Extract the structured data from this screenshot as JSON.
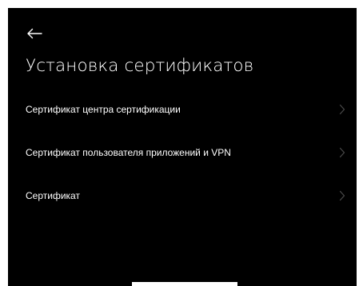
{
  "header": {
    "back_icon": "arrow-left-icon",
    "title": "Установка сертификатов"
  },
  "items": [
    {
      "label": "Сертификат центра сертификации",
      "icon": "chevron-right-icon"
    },
    {
      "label": "Сертификат пользователя приложений и VPN",
      "icon": "chevron-right-icon"
    },
    {
      "label": "Сертификат",
      "icon": "chevron-right-icon"
    }
  ],
  "colors": {
    "background": "#000000",
    "text": "#ffffff",
    "chevron": "#4a4a4a"
  }
}
